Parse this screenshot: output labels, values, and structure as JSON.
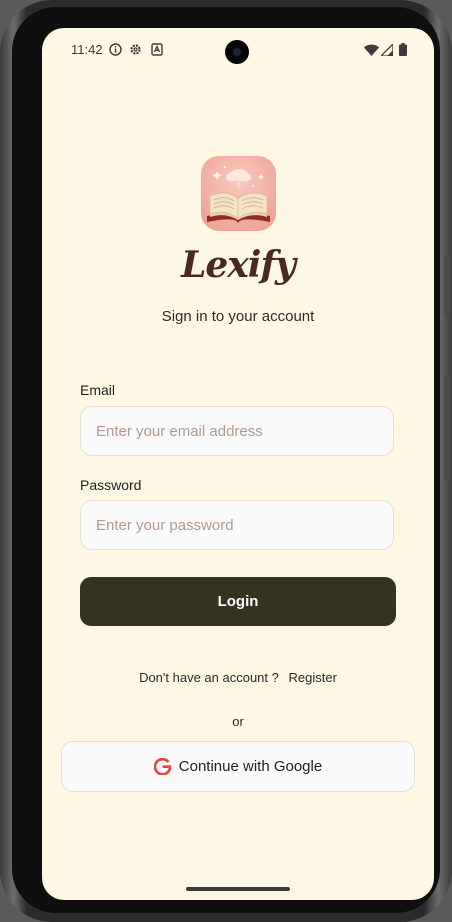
{
  "status_bar": {
    "time": "11:42",
    "left_icons": [
      "info-icon",
      "settings-gear-icon",
      "download-badge-icon"
    ],
    "right_icons": [
      "wifi-icon",
      "signal-icon",
      "battery-icon"
    ]
  },
  "app": {
    "name": "Lexify",
    "logo_icon": "open-book-logo-icon",
    "subtitle": "Sign in to your account"
  },
  "form": {
    "email_label": "Email",
    "email_placeholder": "Enter your email address",
    "email_value": "",
    "password_label": "Password",
    "password_placeholder": "Enter your password",
    "password_value": "",
    "login_label": "Login"
  },
  "footer": {
    "no_account_text": "Don't have an account ?",
    "register_label": "Register",
    "or_text": "or",
    "google_label": "Continue with Google",
    "google_icon": "google-g-icon"
  },
  "colors": {
    "background": "#fdf7e3",
    "login_button": "#33331f",
    "brand_text": "#4a2a1c",
    "placeholder": "#b29a8d"
  }
}
